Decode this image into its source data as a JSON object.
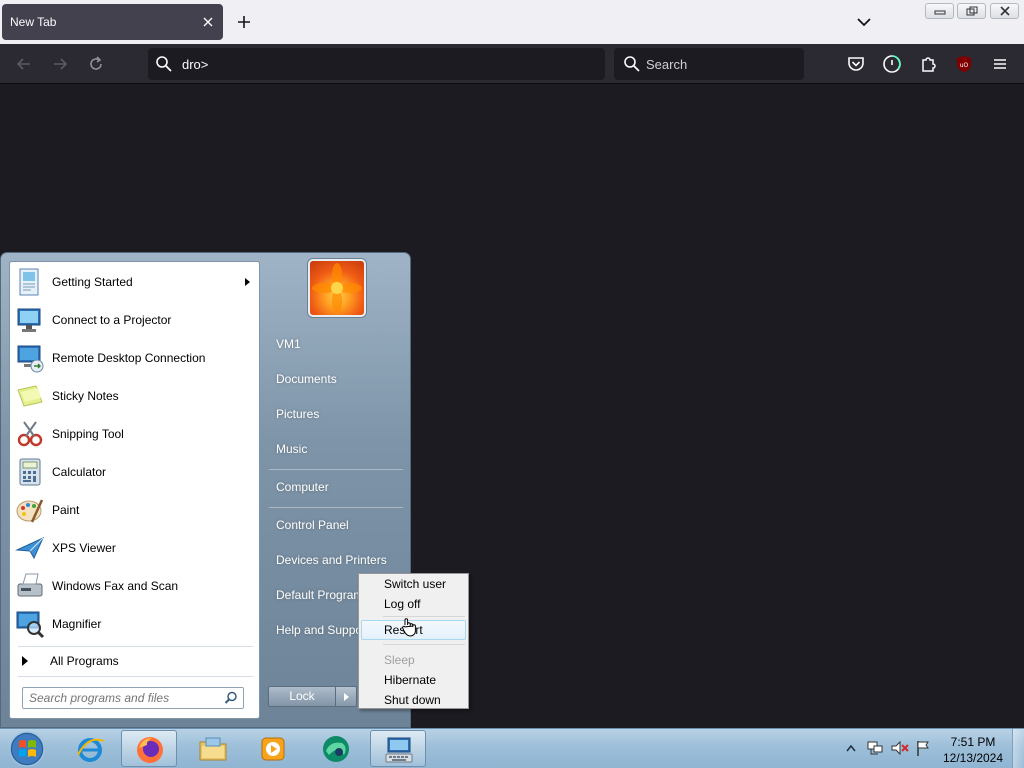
{
  "browser": {
    "tab": {
      "title": "New Tab"
    },
    "url": "dro>",
    "search_placeholder": "Search"
  },
  "start_menu": {
    "programs": [
      {
        "label": "Getting Started",
        "icon": "getting-started-icon",
        "has_submenu": true
      },
      {
        "label": "Connect to a Projector",
        "icon": "projector-icon"
      },
      {
        "label": "Remote Desktop Connection",
        "icon": "remote-desktop-icon"
      },
      {
        "label": "Sticky Notes",
        "icon": "sticky-notes-icon"
      },
      {
        "label": "Snipping Tool",
        "icon": "snipping-tool-icon"
      },
      {
        "label": "Calculator",
        "icon": "calculator-icon"
      },
      {
        "label": "Paint",
        "icon": "paint-icon"
      },
      {
        "label": "XPS Viewer",
        "icon": "xps-viewer-icon"
      },
      {
        "label": "Windows Fax and Scan",
        "icon": "fax-scan-icon"
      },
      {
        "label": "Magnifier",
        "icon": "magnifier-icon"
      }
    ],
    "all_programs": "All Programs",
    "search_placeholder": "Search programs and files",
    "right_links": [
      "VM1",
      "Documents",
      "Pictures",
      "Music",
      "Computer",
      "Control Panel",
      "Devices and Printers",
      "Default Programs",
      "Help and Support"
    ],
    "right_visible": [
      "VM1",
      "Documents",
      "Pictures",
      "Music",
      "Computer",
      "Control Panel",
      "Devices and Printers",
      "Default Program",
      "Help and Suppo"
    ],
    "lock_label": "Lock"
  },
  "power_menu": {
    "items": [
      "Switch user",
      "Log off",
      "Restart",
      "Sleep",
      "Hibernate",
      "Shut down"
    ],
    "highlighted": "Restart",
    "disabled": [
      "Sleep"
    ]
  },
  "taskbar": {
    "apps": [
      "internet-explorer-icon",
      "firefox-icon",
      "file-explorer-icon",
      "media-player-icon",
      "browser-app-icon",
      "keyboard-app-icon"
    ],
    "time": "7:51 PM",
    "date": "12/13/2024"
  }
}
